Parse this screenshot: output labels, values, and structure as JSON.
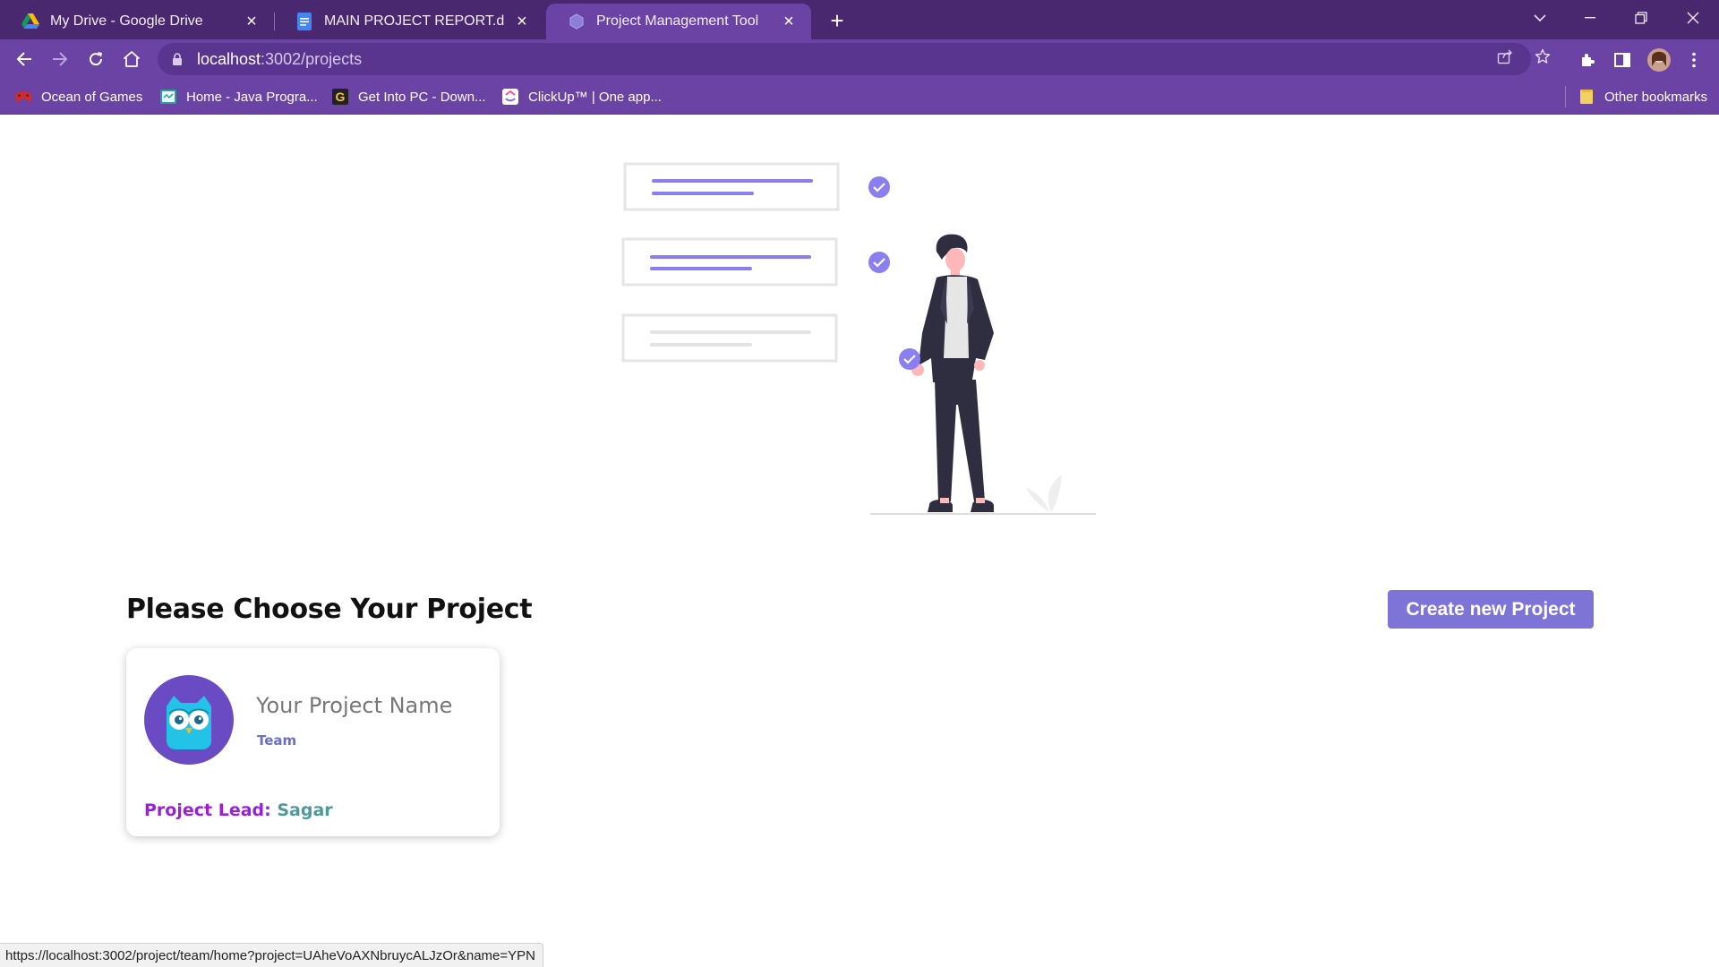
{
  "browser": {
    "tabs": [
      {
        "title": "My Drive - Google Drive",
        "icon": "google-drive-icon"
      },
      {
        "title": "MAIN PROJECT REPORT.docx - G",
        "icon": "google-docs-icon"
      },
      {
        "title": "Project Management Tool",
        "icon": "app-logo-icon",
        "active": true
      }
    ],
    "url_host": "localhost",
    "url_path": ":3002/projects",
    "bookmarks": [
      {
        "label": "Ocean of Games",
        "icon": "gamepad-icon"
      },
      {
        "label": "Home - Java Progra...",
        "icon": "java-site-icon"
      },
      {
        "label": "Get Into PC - Down...",
        "icon": "getintopc-icon"
      },
      {
        "label": "ClickUp™ | One app...",
        "icon": "clickup-icon"
      }
    ],
    "other_bookmarks": "Other bookmarks",
    "status_url": "https://localhost:3002/project/team/home?project=UAheVoAXNbruycALJzOr&name=YPN"
  },
  "page": {
    "heading": "Please Choose Your Project",
    "create_button": "Create new Project",
    "accent_color": "#7e74d8"
  },
  "project_card": {
    "name": "Your Project Name",
    "type": "Team",
    "lead_label": "Project Lead:",
    "lead_name": "Sagar",
    "avatar_icon": "owl-icon"
  }
}
